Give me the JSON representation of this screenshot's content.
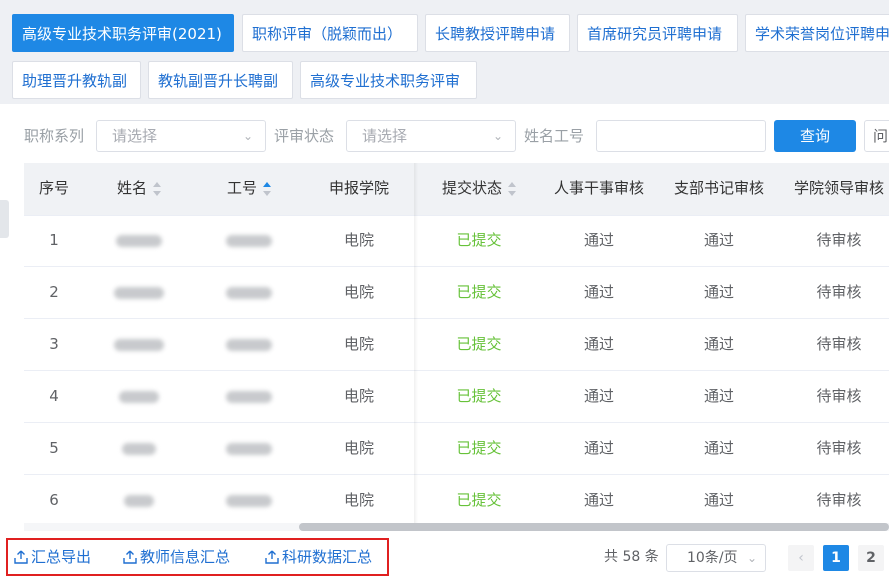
{
  "tabs": [
    {
      "label": "高级专业技术职务评审(2021)",
      "active": true
    },
    {
      "label": "职称评审（脱颖而出）",
      "active": false
    },
    {
      "label": "长聘教授评聘申请",
      "active": false
    },
    {
      "label": "首席研究员评聘申请",
      "active": false
    },
    {
      "label": "学术荣誉岗位评聘申",
      "active": false
    },
    {
      "label": "助理晋升教轨副",
      "active": false
    },
    {
      "label": "教轨副晋升长聘副",
      "active": false
    },
    {
      "label": "高级专业技术职务评审",
      "active": false
    }
  ],
  "filters": {
    "title_series_label": "职称系列",
    "title_series_placeholder": "请选择",
    "review_status_label": "评审状态",
    "review_status_placeholder": "请选择",
    "name_id_label": "姓名工号",
    "name_id_value": "",
    "query_button": "查询",
    "partial_button": "问"
  },
  "table": {
    "columns": [
      "序号",
      "姓名",
      "工号",
      "申报学院",
      "提交状态",
      "人事干事审核",
      "支部书记审核",
      "学院领导审核"
    ],
    "rows": [
      {
        "index": "1",
        "college": "电院",
        "submit": "已提交",
        "hr": "通过",
        "branch": "通过",
        "leader": "待审核"
      },
      {
        "index": "2",
        "college": "电院",
        "submit": "已提交",
        "hr": "通过",
        "branch": "通过",
        "leader": "待审核"
      },
      {
        "index": "3",
        "college": "电院",
        "submit": "已提交",
        "hr": "通过",
        "branch": "通过",
        "leader": "待审核"
      },
      {
        "index": "4",
        "college": "电院",
        "submit": "已提交",
        "hr": "通过",
        "branch": "通过",
        "leader": "待审核"
      },
      {
        "index": "5",
        "college": "电院",
        "submit": "已提交",
        "hr": "通过",
        "branch": "通过",
        "leader": "待审核"
      },
      {
        "index": "6",
        "college": "电院",
        "submit": "已提交",
        "hr": "通过",
        "branch": "通过",
        "leader": "待审核"
      }
    ]
  },
  "footer": {
    "export_summary": "汇总导出",
    "teacher_info_summary": "教师信息汇总",
    "research_data_summary": "科研数据汇总",
    "total": "共 58 条",
    "page_size": "10条/页",
    "pages": [
      "1",
      "2"
    ]
  },
  "colors": {
    "accent": "#1e88e5",
    "status_green": "#67c23a",
    "highlight_box": "#e02020"
  },
  "icons": {
    "export": "upload-icon",
    "select": "chevron-down-icon",
    "prev": "chevron-left-icon"
  }
}
